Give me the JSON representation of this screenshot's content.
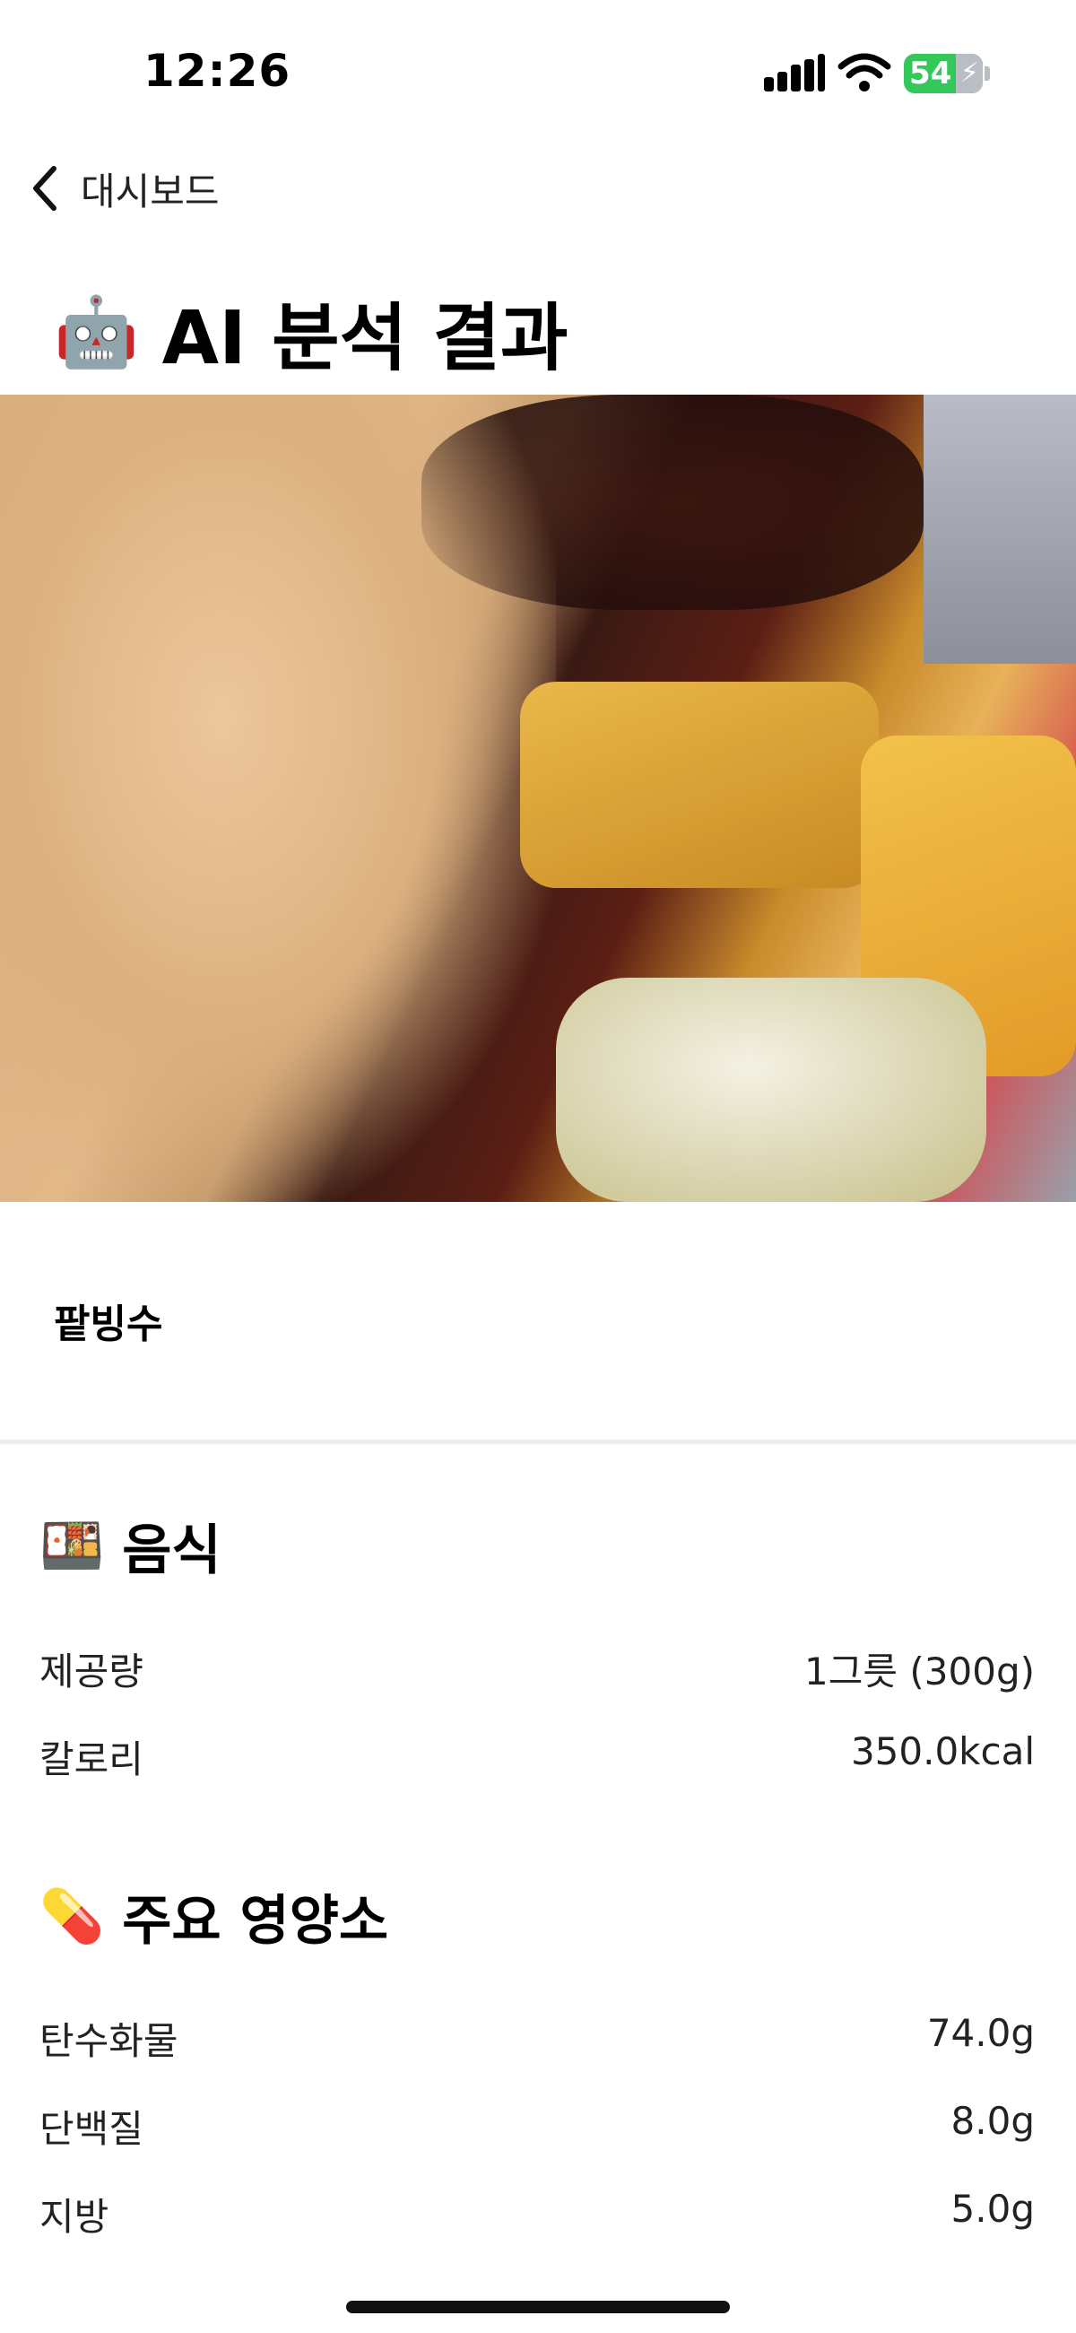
{
  "status_bar": {
    "time": "12:26",
    "battery": "54"
  },
  "nav": {
    "back_label": "대시보드"
  },
  "page": {
    "title_emoji": "🤖",
    "title": "AI 분석 결과"
  },
  "food": {
    "name": "팥빙수"
  },
  "section_food": {
    "emoji": "🍱",
    "title": "음식",
    "rows": [
      {
        "label": "제공량",
        "value": "1그릇 (300g)"
      },
      {
        "label": "칼로리",
        "value": "350.0kcal"
      }
    ]
  },
  "section_nutrients": {
    "emoji": "💊",
    "title": "주요 영양소",
    "rows": [
      {
        "label": "탄수화물",
        "value": "74.0g"
      },
      {
        "label": "단백질",
        "value": "8.0g"
      },
      {
        "label": "지방",
        "value": "5.0g"
      }
    ]
  }
}
